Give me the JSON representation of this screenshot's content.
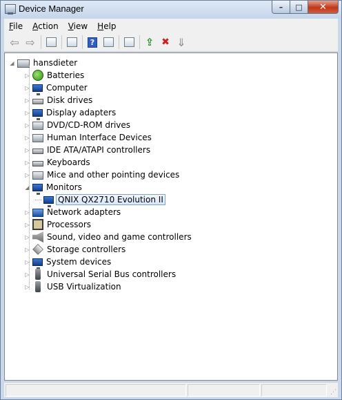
{
  "window": {
    "title": "Device Manager"
  },
  "title_buttons": {
    "minimize": "–",
    "maximize": "□",
    "close": "✕"
  },
  "menu": [
    {
      "accel": "F",
      "rest": "ile"
    },
    {
      "accel": "A",
      "rest": "ction"
    },
    {
      "accel": "V",
      "rest": "iew"
    },
    {
      "accel": "H",
      "rest": "elp"
    }
  ],
  "tree": {
    "root": "hansdieter",
    "categories": [
      {
        "label": "Batteries",
        "icon": "battery-icon",
        "expanded": false
      },
      {
        "label": "Computer",
        "icon": "computer-icon",
        "expanded": false
      },
      {
        "label": "Disk drives",
        "icon": "disk-drive-icon",
        "expanded": false
      },
      {
        "label": "Display adapters",
        "icon": "display-adapter-icon",
        "expanded": false
      },
      {
        "label": "DVD/CD-ROM drives",
        "icon": "dvd-drive-icon",
        "expanded": false
      },
      {
        "label": "Human Interface Devices",
        "icon": "hid-icon",
        "expanded": false
      },
      {
        "label": "IDE ATA/ATAPI controllers",
        "icon": "ide-controller-icon",
        "expanded": false
      },
      {
        "label": "Keyboards",
        "icon": "keyboard-icon",
        "expanded": false
      },
      {
        "label": "Mice and other pointing devices",
        "icon": "mouse-icon",
        "expanded": false
      },
      {
        "label": "Monitors",
        "icon": "monitor-icon",
        "expanded": true
      },
      {
        "label": "QNIX QX2710 Evolution II",
        "icon": "monitor-icon",
        "child": true,
        "selected": true
      },
      {
        "label": "Network adapters",
        "icon": "network-adapter-icon",
        "expanded": false
      },
      {
        "label": "Processors",
        "icon": "processor-icon",
        "expanded": false
      },
      {
        "label": "Sound, video and game controllers",
        "icon": "speaker-icon",
        "expanded": false
      },
      {
        "label": "Storage controllers",
        "icon": "storage-controller-icon",
        "expanded": false
      },
      {
        "label": "System devices",
        "icon": "system-device-icon",
        "expanded": false
      },
      {
        "label": "Universal Serial Bus controllers",
        "icon": "usb-icon",
        "expanded": false
      },
      {
        "label": "USB Virtualization",
        "icon": "usb-icon",
        "expanded": false
      }
    ]
  },
  "colors": {
    "frame": "#c9d8ea",
    "selection": "#d5e6fb",
    "close_button": "#c1381b"
  }
}
